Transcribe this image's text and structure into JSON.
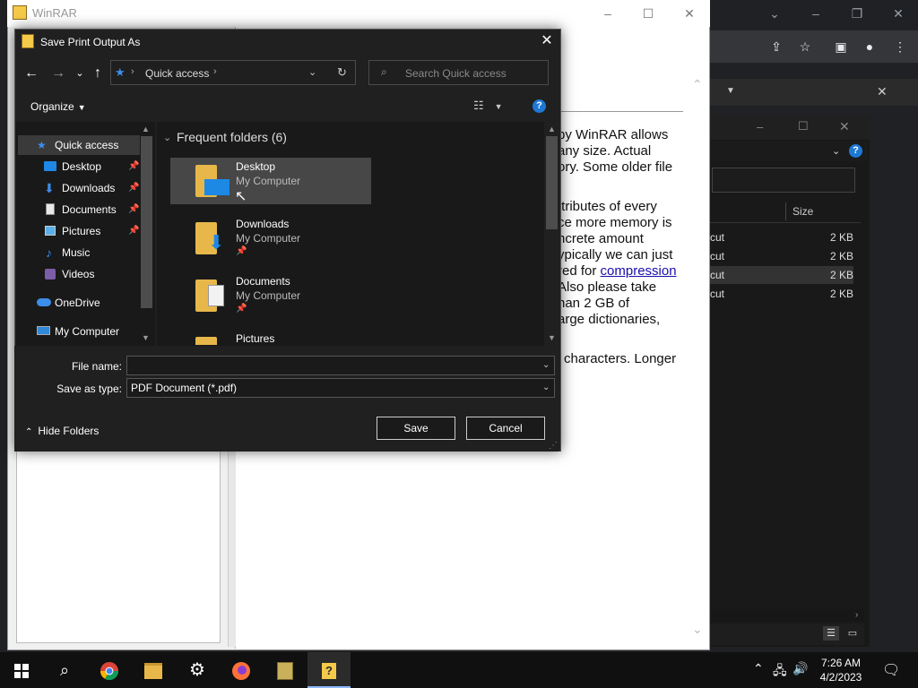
{
  "colors": {
    "accent": "#1e78d4",
    "dialog_bg": "#202020",
    "taskbar_bg": "#101010"
  },
  "winrar": {
    "title": "WinRAR",
    "content_lines": [
      "by WinRAR allows",
      "any size. Actual",
      "ory. Some older file",
      "ttributes of every",
      "ce more memory is",
      "ncrete amount",
      "ypically we can just",
      "red for ",
      "Also please take",
      "nan 2 GB of",
      "arge dictionaries,",
      "' characters. Longer"
    ],
    "link_text": "compression"
  },
  "explorer_bg": {
    "col_size": "Size",
    "rows": [
      {
        "type": "cut",
        "size": "2 KB"
      },
      {
        "type": "cut",
        "size": "2 KB"
      },
      {
        "type": "cut",
        "size": "2 KB"
      },
      {
        "type": "cut",
        "size": "2 KB"
      }
    ]
  },
  "dialog": {
    "title": "Save Print Output As",
    "address": "Quick access",
    "search_placeholder": "Search Quick access",
    "organize_label": "Organize",
    "nav_items": [
      {
        "label": "Quick access",
        "icon": "star-icon"
      },
      {
        "label": "Desktop",
        "icon": "desktop-folder-icon"
      },
      {
        "label": "Downloads",
        "icon": "downloads-folder-icon"
      },
      {
        "label": "Documents",
        "icon": "documents-folder-icon"
      },
      {
        "label": "Pictures",
        "icon": "pictures-folder-icon"
      },
      {
        "label": "Music",
        "icon": "music-folder-icon"
      },
      {
        "label": "Videos",
        "icon": "videos-folder-icon"
      },
      {
        "label": "OneDrive",
        "icon": "cloud-icon"
      },
      {
        "label": "My Computer",
        "icon": "computer-icon"
      }
    ],
    "group_header": "Frequent folders (6)",
    "folders": [
      {
        "name": "Desktop",
        "location": "My Computer"
      },
      {
        "name": "Downloads",
        "location": "My Computer"
      },
      {
        "name": "Documents",
        "location": "My Computer"
      },
      {
        "name": "Pictures",
        "location": ""
      }
    ],
    "file_name_label": "File name:",
    "file_name_value": "",
    "save_type_label": "Save as type:",
    "save_type_value": "PDF Document (*.pdf)",
    "hide_folders_label": "Hide Folders",
    "save_label": "Save",
    "cancel_label": "Cancel"
  },
  "taskbar": {
    "time": "7:26 AM",
    "date": "4/2/2023"
  }
}
